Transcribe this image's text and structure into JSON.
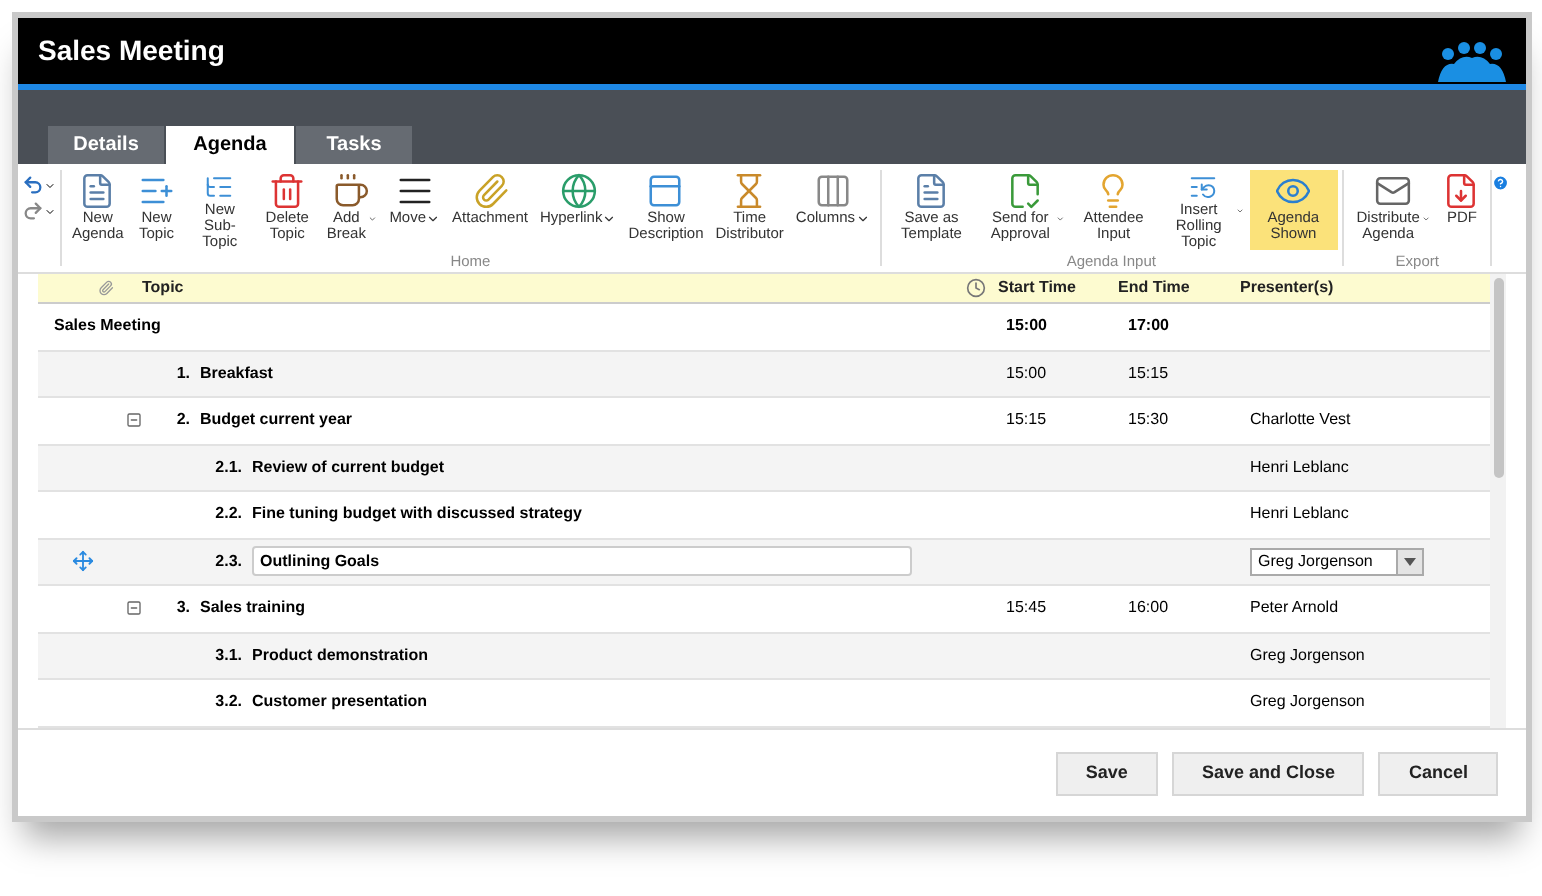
{
  "window": {
    "title": "Sales Meeting"
  },
  "tabs": [
    {
      "label": "Details",
      "selected": false
    },
    {
      "label": "Agenda",
      "selected": true
    },
    {
      "label": "Tasks",
      "selected": false
    }
  ],
  "ribbon": {
    "groups": [
      {
        "label": "Home",
        "buttons": [
          {
            "label": "New Agenda",
            "dropdown": false,
            "selected": false
          },
          {
            "label": "New Topic",
            "dropdown": false,
            "selected": false
          },
          {
            "label": "New Sub-Topic",
            "dropdown": false,
            "selected": false
          },
          {
            "label": "Delete Topic",
            "dropdown": false,
            "selected": false
          },
          {
            "label": "Add Break",
            "dropdown": true,
            "selected": false
          },
          {
            "label": "Move",
            "dropdown": true,
            "selected": false
          },
          {
            "label": "Attachment",
            "dropdown": false,
            "selected": false
          },
          {
            "label": "Hyperlink",
            "dropdown": true,
            "selected": false
          },
          {
            "label": "Show Description",
            "dropdown": false,
            "selected": false
          },
          {
            "label": "Time Distributor",
            "dropdown": false,
            "selected": false
          },
          {
            "label": "Columns",
            "dropdown": true,
            "selected": false
          }
        ]
      },
      {
        "label": "Agenda Input",
        "buttons": [
          {
            "label": "Save as Template",
            "dropdown": false,
            "selected": false
          },
          {
            "label": "Send for Approval",
            "dropdown": true,
            "selected": false
          },
          {
            "label": "Attendee Input",
            "dropdown": false,
            "selected": false
          },
          {
            "label": "Insert Rolling Topic",
            "dropdown": true,
            "selected": false
          },
          {
            "label": "Agenda Shown",
            "dropdown": false,
            "selected": true
          }
        ]
      },
      {
        "label": "Export",
        "buttons": [
          {
            "label": "Distribute Agenda",
            "dropdown": true,
            "selected": false
          },
          {
            "label": "PDF",
            "dropdown": false,
            "selected": false
          }
        ]
      }
    ]
  },
  "table": {
    "columns": [
      "Topic",
      "Start Time",
      "End Time",
      "Presenter(s)"
    ],
    "rows": [
      {
        "kind": "meeting",
        "title": "Sales Meeting",
        "start": "15:00",
        "end": "17:00",
        "children": [
          {
            "kind": "topic",
            "number": "1.",
            "title": "Breakfast",
            "start": "15:00",
            "end": "15:15"
          },
          {
            "kind": "topic",
            "number": "2.",
            "title": "Budget current year",
            "start": "15:15",
            "end": "15:30",
            "presenter": "Charlotte Vest",
            "expanded": true,
            "children": [
              {
                "kind": "topic",
                "number": "2.1.",
                "title": "Review of current budget",
                "presenter": "Henri Leblanc"
              },
              {
                "kind": "topic",
                "number": "2.2.",
                "title": "Fine tuning budget with discussed strategy",
                "presenter": "Henri Leblanc"
              },
              {
                "kind": "editing",
                "number": "2.3.",
                "title": "Outlining Goals",
                "presenter": "Greg Jorgenson"
              }
            ]
          },
          {
            "kind": "topic",
            "number": "3.",
            "title": "Sales training",
            "start": "15:45",
            "end": "16:00",
            "presenter": "Peter Arnold",
            "expanded": true,
            "children": [
              {
                "kind": "topic",
                "number": "3.1.",
                "title": "Product demonstration",
                "presenter": "Greg Jorgenson"
              },
              {
                "kind": "topic",
                "number": "3.2.",
                "title": "Customer presentation",
                "presenter": "Greg Jorgenson"
              }
            ]
          }
        ]
      }
    ]
  },
  "buttons": [
    "Save",
    "Save and Close",
    "Cancel"
  ]
}
